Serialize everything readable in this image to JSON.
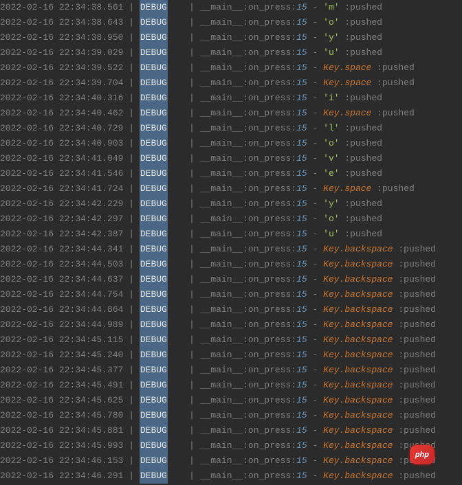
{
  "log": {
    "module_label": "__main__:on_press:",
    "line_number": "15",
    "pushed_label": " :pushed",
    "sep_pipe": " | ",
    "sep_pipe2": "| ",
    "dash": " - ",
    "debug_label": "DEBUG",
    "debug_pad": "    ",
    "entries": [
      {
        "ts": "2022-02-16 22:34:38.561",
        "key": "'m'",
        "type": "char"
      },
      {
        "ts": "2022-02-16 22:34:38.643",
        "key": "'o'",
        "type": "char"
      },
      {
        "ts": "2022-02-16 22:34:38.950",
        "key": "'y'",
        "type": "char"
      },
      {
        "ts": "2022-02-16 22:34:39.029",
        "key": "'u'",
        "type": "char"
      },
      {
        "ts": "2022-02-16 22:34:39.522",
        "key": "Key.space",
        "type": "special"
      },
      {
        "ts": "2022-02-16 22:34:39.704",
        "key": "Key.space",
        "type": "special"
      },
      {
        "ts": "2022-02-16 22:34:40.316",
        "key": "'i'",
        "type": "char"
      },
      {
        "ts": "2022-02-16 22:34:40.462",
        "key": "Key.space",
        "type": "special"
      },
      {
        "ts": "2022-02-16 22:34:40.729",
        "key": "'l'",
        "type": "char"
      },
      {
        "ts": "2022-02-16 22:34:40.903",
        "key": "'o'",
        "type": "char"
      },
      {
        "ts": "2022-02-16 22:34:41.049",
        "key": "'v'",
        "type": "char"
      },
      {
        "ts": "2022-02-16 22:34:41.546",
        "key": "'e'",
        "type": "char"
      },
      {
        "ts": "2022-02-16 22:34:41.724",
        "key": "Key.space",
        "type": "special"
      },
      {
        "ts": "2022-02-16 22:34:42.229",
        "key": "'y'",
        "type": "char"
      },
      {
        "ts": "2022-02-16 22:34:42.297",
        "key": "'o'",
        "type": "char"
      },
      {
        "ts": "2022-02-16 22:34:42.387",
        "key": "'u'",
        "type": "char"
      },
      {
        "ts": "2022-02-16 22:34:44.341",
        "key": "Key.backspace",
        "type": "special"
      },
      {
        "ts": "2022-02-16 22:34:44.503",
        "key": "Key.backspace",
        "type": "special"
      },
      {
        "ts": "2022-02-16 22:34:44.637",
        "key": "Key.backspace",
        "type": "special"
      },
      {
        "ts": "2022-02-16 22:34:44.754",
        "key": "Key.backspace",
        "type": "special"
      },
      {
        "ts": "2022-02-16 22:34:44.864",
        "key": "Key.backspace",
        "type": "special"
      },
      {
        "ts": "2022-02-16 22:34:44.989",
        "key": "Key.backspace",
        "type": "special"
      },
      {
        "ts": "2022-02-16 22:34:45.115",
        "key": "Key.backspace",
        "type": "special"
      },
      {
        "ts": "2022-02-16 22:34:45.240",
        "key": "Key.backspace",
        "type": "special"
      },
      {
        "ts": "2022-02-16 22:34:45.377",
        "key": "Key.backspace",
        "type": "special"
      },
      {
        "ts": "2022-02-16 22:34:45.491",
        "key": "Key.backspace",
        "type": "special"
      },
      {
        "ts": "2022-02-16 22:34:45.625",
        "key": "Key.backspace",
        "type": "special"
      },
      {
        "ts": "2022-02-16 22:34:45.780",
        "key": "Key.backspace",
        "type": "special"
      },
      {
        "ts": "2022-02-16 22:34:45.881",
        "key": "Key.backspace",
        "type": "special"
      },
      {
        "ts": "2022-02-16 22:34:45.993",
        "key": "Key.backspace",
        "type": "special"
      },
      {
        "ts": "2022-02-16 22:34:46.153",
        "key": "Key.backspace",
        "type": "special"
      },
      {
        "ts": "2022-02-16 22:34:46.291",
        "key": "Key.backspace",
        "type": "special"
      }
    ]
  },
  "badge": {
    "text": "php"
  }
}
